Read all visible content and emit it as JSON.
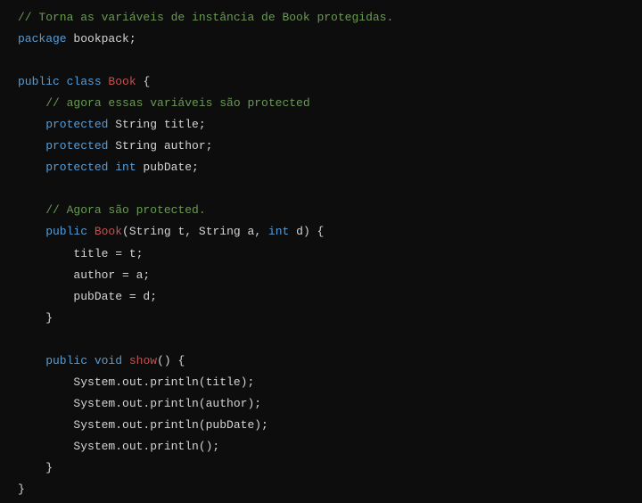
{
  "code": {
    "l1_comment": "// Torna as variáveis de instância de Book protegidas.",
    "l2_kw_package": "package",
    "l2_pkg": " bookpack;",
    "l4_kw_public": "public",
    "l4_kw_class": " class ",
    "l4_class": "Book",
    "l4_brace": " {",
    "l5_comment": "    // agora essas variáveis são protected",
    "l6_kw": "    protected",
    "l6_rest": " String title;",
    "l7_kw": "    protected",
    "l7_rest": " String author;",
    "l8_kw": "    protected ",
    "l8_int": "int",
    "l8_rest": " pubDate;",
    "l10_comment": "    // Agora são protected.",
    "l11_kw_public": "    public ",
    "l11_ctor": "Book",
    "l11_paren_open": "(",
    "l11_p1t": "String t",
    "l11_c1": ", ",
    "l11_p2t": "String a",
    "l11_c2": ", ",
    "l11_p3t_int": "int",
    "l11_p3n": " d",
    "l11_end": ") {",
    "l12": "        title = t;",
    "l13": "        author = a;",
    "l14": "        pubDate = d;",
    "l15": "    }",
    "l17_kw_public": "    public ",
    "l17_void": "void ",
    "l17_name": "show",
    "l17_end": "() {",
    "l18": "        System.out.println(title);",
    "l19": "        System.out.println(author);",
    "l20": "        System.out.println(pubDate);",
    "l21": "        System.out.println();",
    "l22": "    }",
    "l23": "}"
  }
}
